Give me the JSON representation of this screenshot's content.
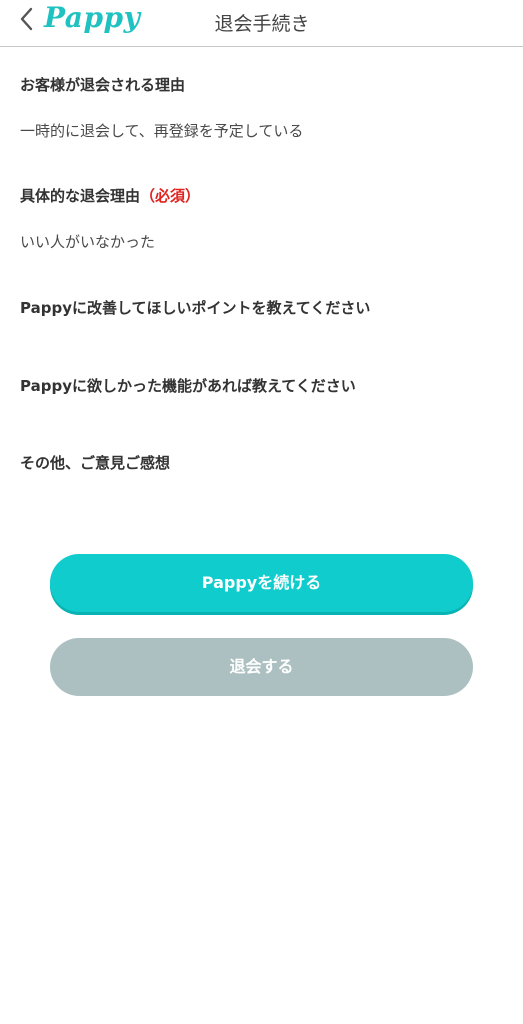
{
  "header": {
    "logo_text": "Pappy",
    "title": "退会手続き"
  },
  "form": {
    "reason_label": "お客様が退会される理由",
    "reason_value": "一時的に退会して、再登録を予定している",
    "detail_label": "具体的な退会理由",
    "detail_required": "（必須）",
    "detail_value": "いい人がいなかった",
    "improve_label": "Pappyに改善してほしいポイントを教えてください",
    "feature_label": "Pappyに欲しかった機能があれば教えてください",
    "other_label": "その他、ご意見ご感想"
  },
  "actions": {
    "continue_label": "Pappyを続ける",
    "withdraw_label": "退会する"
  },
  "colors": {
    "brand": "#1fc1c1",
    "continue_button": "#10cccc",
    "withdraw_button": "#adc0c1",
    "required": "#e0231f"
  }
}
